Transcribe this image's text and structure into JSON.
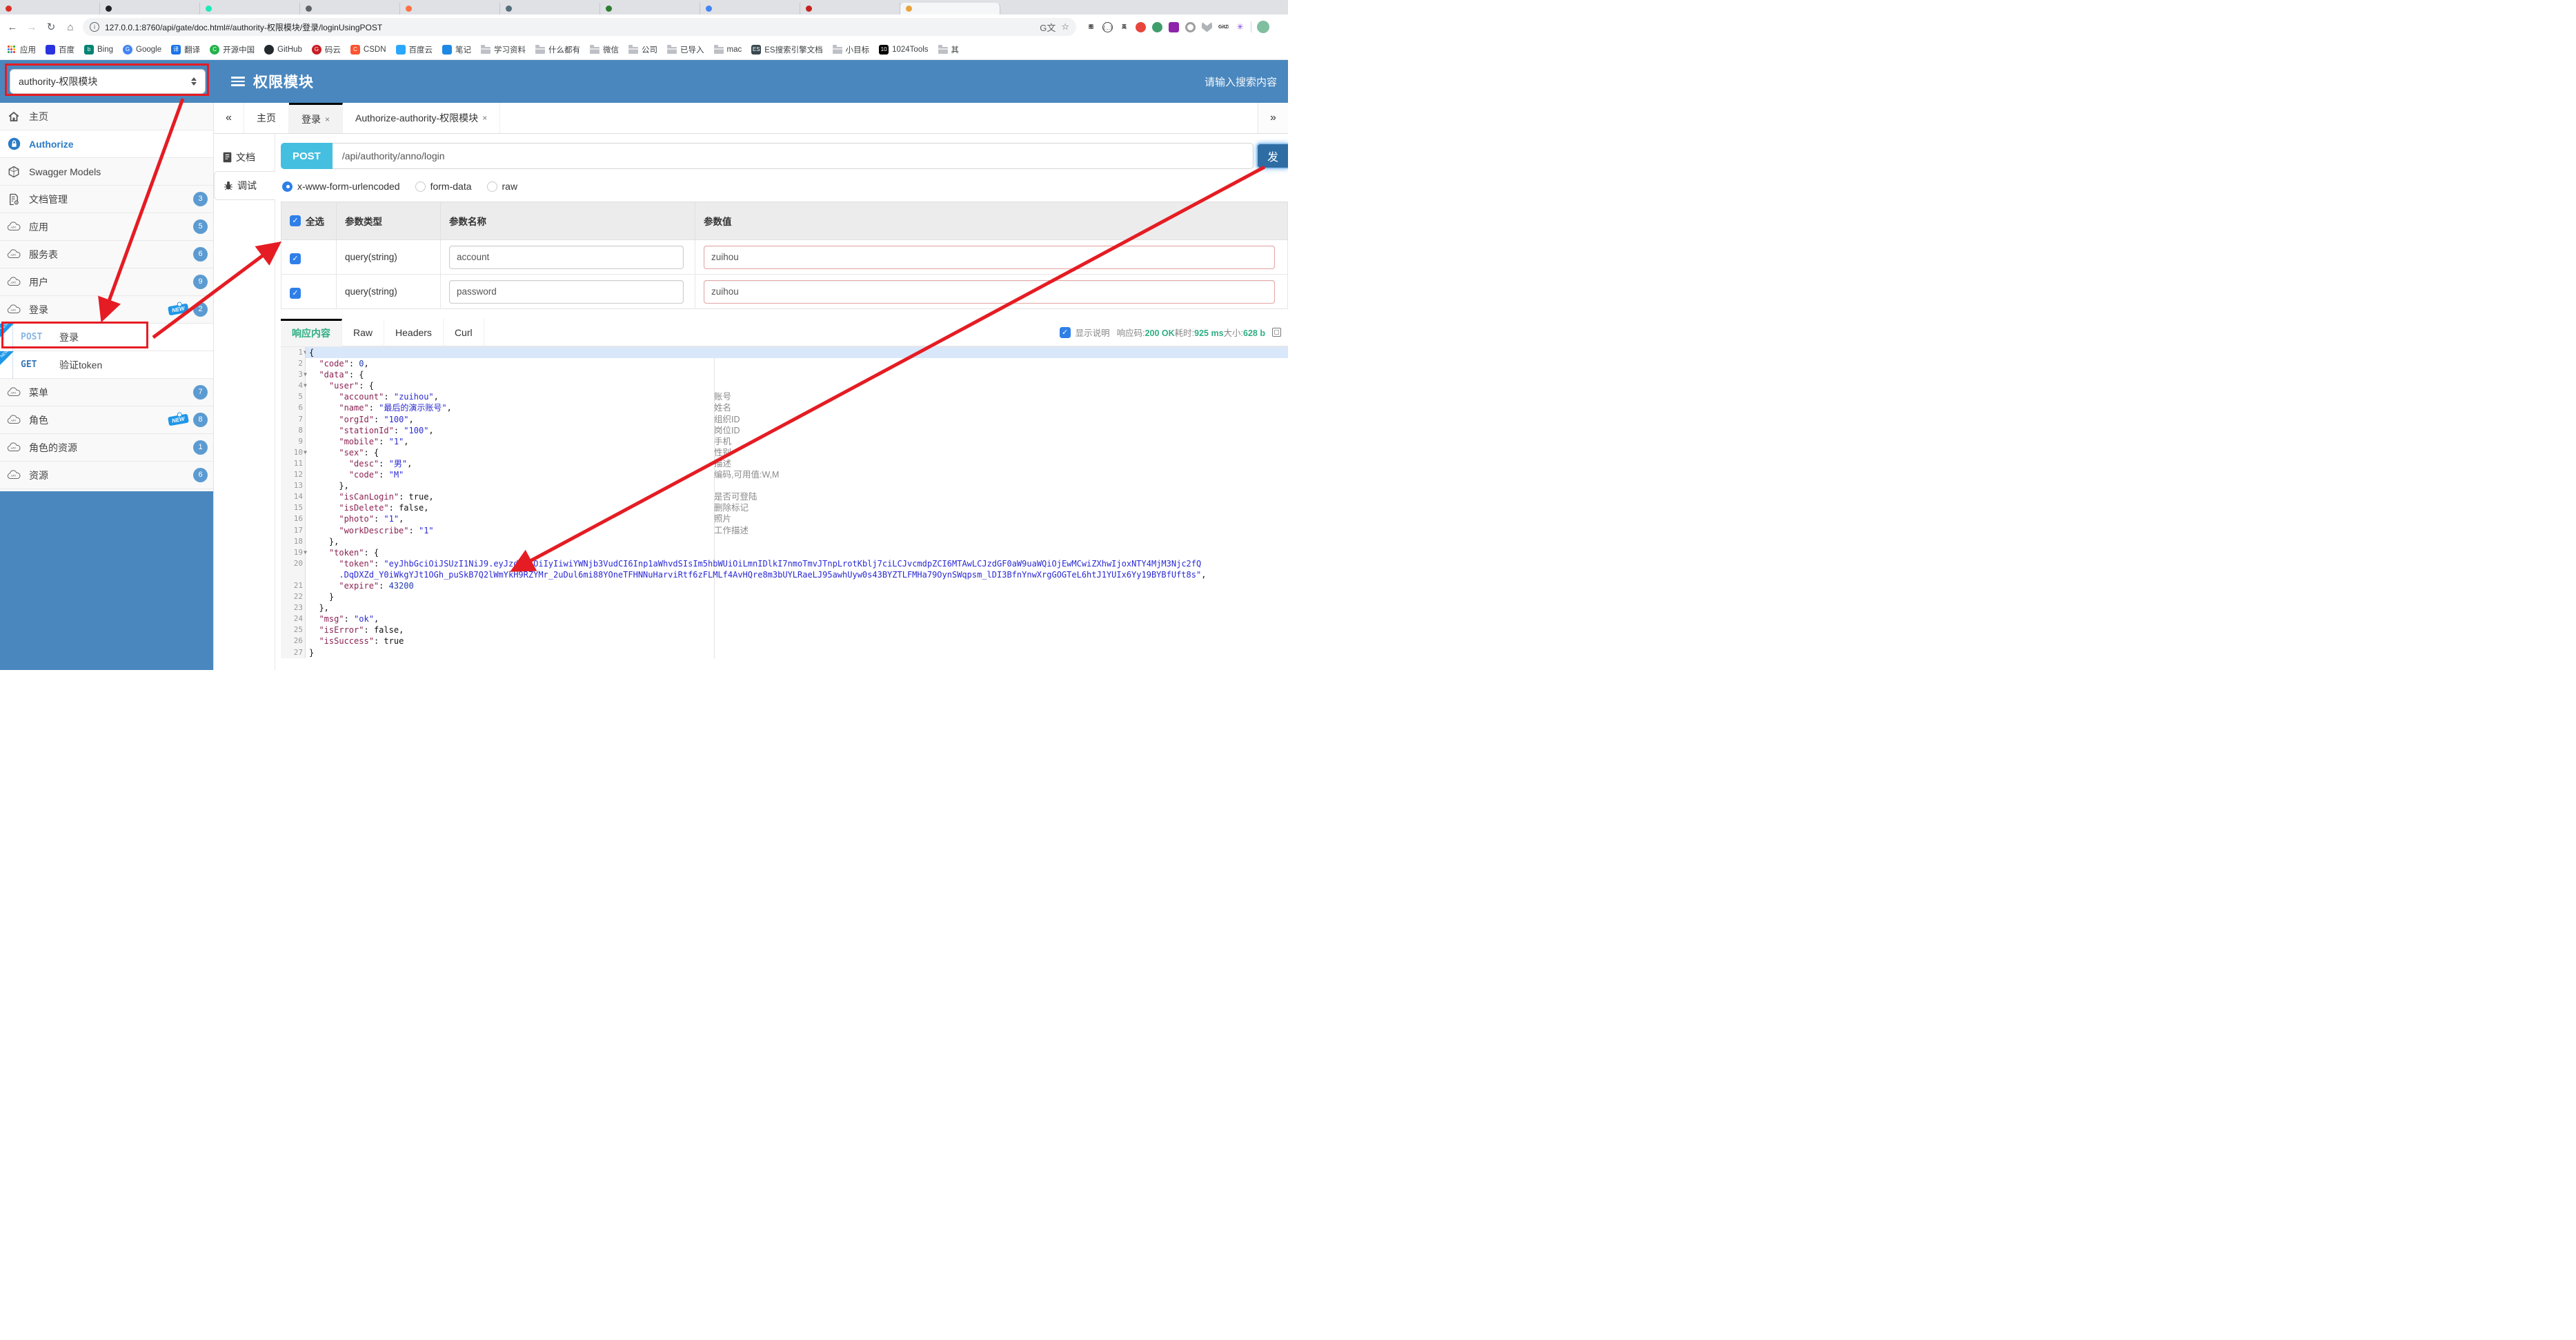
{
  "colors": {
    "header_blue": "#4a87be",
    "badge_blue": "#5b9bd1",
    "annotation_red": "#e51c23",
    "method_teal": "#45bfdf",
    "success_green": "#2fae83",
    "send_navy": "#2e6da4",
    "new_blue": "#1f97e8"
  },
  "browser": {
    "tabs": [
      {
        "color": "#d93025"
      },
      {
        "color": "#202124"
      },
      {
        "color": "#1de9b6"
      },
      {
        "color": "#5f6368"
      },
      {
        "color": "#ff7043"
      },
      {
        "color": "#546e7a"
      },
      {
        "color": "#2e7d32"
      },
      {
        "color": "#4285f4"
      },
      {
        "color": "#c5221f"
      },
      {
        "color": "#e8a33d",
        "active": true
      }
    ],
    "nav": {
      "back": "←",
      "forward": "→",
      "reload": "↻",
      "home": "⌂",
      "info": "ⓘ",
      "star": "☆"
    },
    "url": "127.0.0.1:8760/api/gate/doc.html#/authority-权限模块/登录/loginUsingPOST",
    "extensions": [
      {
        "kind": "txt",
        "label": "图",
        "bg": ""
      },
      {
        "kind": "outline",
        "label": "{…}",
        "bg": ""
      },
      {
        "kind": "txt",
        "label": "英",
        "bg": ""
      },
      {
        "kind": "round",
        "label": "",
        "bg": "#e8453c"
      },
      {
        "kind": "round",
        "label": "",
        "bg": "#3f9d6b"
      },
      {
        "kind": "sq",
        "label": "",
        "bg": "#8e24aa"
      },
      {
        "kind": "ring",
        "label": "",
        "bg": "#9e9e9e"
      },
      {
        "kind": "chev",
        "label": "",
        "bg": "#b0b4b8"
      },
      {
        "kind": "txt",
        "label": "GitZip",
        "bg": ""
      },
      {
        "kind": "star",
        "label": "✳",
        "bg": ""
      }
    ],
    "bookmarks": [
      {
        "label": "应用",
        "icon": "apps"
      },
      {
        "label": "百度",
        "icon": "sq",
        "bg": "#2932e1",
        "glyph": ""
      },
      {
        "label": "Bing",
        "icon": "sq",
        "bg": "#008373",
        "glyph": "b"
      },
      {
        "label": "Google",
        "icon": "round",
        "bg": "#4285f4",
        "glyph": "G"
      },
      {
        "label": "翻译",
        "icon": "sq",
        "bg": "#1a73e8",
        "glyph": "译"
      },
      {
        "label": "开源中国",
        "icon": "round",
        "bg": "#24b34b",
        "glyph": "C"
      },
      {
        "label": "GitHub",
        "icon": "round",
        "bg": "#24292e",
        "glyph": ""
      },
      {
        "label": "码云",
        "icon": "round",
        "bg": "#c71d23",
        "glyph": "G"
      },
      {
        "label": "CSDN",
        "icon": "sq",
        "bg": "#fc5531",
        "glyph": "C"
      },
      {
        "label": "百度云",
        "icon": "sq",
        "bg": "#2aa7ff",
        "glyph": ""
      },
      {
        "label": "笔记",
        "icon": "sq",
        "bg": "#1e88e5",
        "glyph": ""
      },
      {
        "label": "学习资料",
        "icon": "folder"
      },
      {
        "label": "什么都有",
        "icon": "folder"
      },
      {
        "label": "微信",
        "icon": "folder"
      },
      {
        "label": "公司",
        "icon": "folder"
      },
      {
        "label": "已导入",
        "icon": "folder"
      },
      {
        "label": "mac",
        "icon": "folder"
      },
      {
        "label": "ES搜索引擎文档",
        "icon": "sq",
        "bg": "#37474f",
        "glyph": "ES"
      },
      {
        "label": "小目标",
        "icon": "folder"
      },
      {
        "label": "1024Tools",
        "icon": "sq",
        "bg": "#000000",
        "glyph": "10"
      },
      {
        "label": "其",
        "icon": "folder"
      }
    ]
  },
  "header": {
    "module_select": "authority-权限模块",
    "title": "权限模块",
    "search_placeholder": "请输入搜索内容"
  },
  "sidebar": {
    "items": [
      {
        "label": "主页",
        "icon": "home"
      },
      {
        "label": "Authorize",
        "icon": "lock",
        "selected": true
      },
      {
        "label": "Swagger Models",
        "icon": "hexagon"
      },
      {
        "label": "文档管理",
        "icon": "docgear",
        "badge": "3"
      },
      {
        "label": "应用",
        "icon": "cloud",
        "badge": "5"
      },
      {
        "label": "服务表",
        "icon": "cloud",
        "badge": "6"
      },
      {
        "label": "用户",
        "icon": "cloud",
        "badge": "9"
      },
      {
        "label": "登录",
        "icon": "cloud",
        "badge": "2",
        "new": true
      },
      {
        "op": true,
        "method": "POST",
        "label": "登录",
        "corner_new": true
      },
      {
        "op": true,
        "method": "GET",
        "label": "验证token",
        "corner_new": true
      },
      {
        "label": "菜单",
        "icon": "cloud",
        "badge": "7"
      },
      {
        "label": "角色",
        "icon": "cloud",
        "badge": "8",
        "new": true
      },
      {
        "label": "角色的资源",
        "icon": "cloud",
        "badge": "1"
      },
      {
        "label": "资源",
        "icon": "cloud",
        "badge": "6"
      }
    ],
    "new_label": "NEW"
  },
  "tabbar": {
    "collapse": "«",
    "expand": "»",
    "close_glyph": "×",
    "tabs": [
      {
        "label": "主页"
      },
      {
        "label": "登录",
        "closable": true,
        "active": true
      },
      {
        "label": "Authorize-authority-权限模块",
        "closable": true
      }
    ]
  },
  "doc_panel": {
    "tabs": [
      {
        "label": "文档",
        "icon": "doc"
      },
      {
        "label": "调试",
        "icon": "bug",
        "active": true
      }
    ]
  },
  "endpoint": {
    "method": "POST",
    "path": "/api/authority/anno/login",
    "send_label": "发"
  },
  "body_type": {
    "options": [
      {
        "label": "x-www-form-urlencoded",
        "selected": true
      },
      {
        "label": "form-data",
        "selected": false
      },
      {
        "label": "raw",
        "selected": false
      }
    ]
  },
  "params_table": {
    "select_all_label": "全选",
    "check_glyph": "✓",
    "headers": [
      "参数类型",
      "参数名称",
      "参数值"
    ],
    "rows": [
      {
        "checked": true,
        "type": "query(string)",
        "name": "account",
        "value": "zuihou"
      },
      {
        "checked": true,
        "type": "query(string)",
        "name": "password",
        "value": "zuihou"
      }
    ]
  },
  "response": {
    "tabs": [
      {
        "label": "响应内容",
        "active": true
      },
      {
        "label": "Raw"
      },
      {
        "label": "Headers"
      },
      {
        "label": "Curl"
      }
    ],
    "show_desc_label": "显示说明",
    "meta": [
      {
        "label": "响应码:",
        "value": "200 OK"
      },
      {
        "label": "耗时:",
        "value": "925 ms"
      },
      {
        "label": "大小:",
        "value": "628 b"
      }
    ]
  },
  "code": {
    "fold_glyph": "▼",
    "lines": [
      {
        "n": 1,
        "fold": true,
        "active": true,
        "toks": [
          [
            "p",
            "{"
          ]
        ]
      },
      {
        "n": 2,
        "toks": [
          [
            "p",
            "  "
          ],
          [
            "k",
            "\"code\""
          ],
          [
            "p",
            ": "
          ],
          [
            "num",
            "0"
          ],
          [
            "p",
            ","
          ]
        ]
      },
      {
        "n": 3,
        "fold": true,
        "toks": [
          [
            "p",
            "  "
          ],
          [
            "k",
            "\"data\""
          ],
          [
            "p",
            ": {"
          ]
        ]
      },
      {
        "n": 4,
        "fold": true,
        "toks": [
          [
            "p",
            "    "
          ],
          [
            "k",
            "\"user\""
          ],
          [
            "p",
            ": {"
          ]
        ]
      },
      {
        "n": 5,
        "ann": "账号",
        "toks": [
          [
            "p",
            "      "
          ],
          [
            "k",
            "\"account\""
          ],
          [
            "p",
            ": "
          ],
          [
            "s",
            "\"zuihou\""
          ],
          [
            "p",
            ","
          ]
        ]
      },
      {
        "n": 6,
        "ann": "姓名",
        "toks": [
          [
            "p",
            "      "
          ],
          [
            "k",
            "\"name\""
          ],
          [
            "p",
            ": "
          ],
          [
            "s",
            "\"最后的演示账号\""
          ],
          [
            "p",
            ","
          ]
        ]
      },
      {
        "n": 7,
        "ann": "组织ID",
        "toks": [
          [
            "p",
            "      "
          ],
          [
            "k",
            "\"orgId\""
          ],
          [
            "p",
            ": "
          ],
          [
            "s",
            "\"100\""
          ],
          [
            "p",
            ","
          ]
        ]
      },
      {
        "n": 8,
        "ann": "岗位ID",
        "toks": [
          [
            "p",
            "      "
          ],
          [
            "k",
            "\"stationId\""
          ],
          [
            "p",
            ": "
          ],
          [
            "s",
            "\"100\""
          ],
          [
            "p",
            ","
          ]
        ]
      },
      {
        "n": 9,
        "ann": "手机",
        "toks": [
          [
            "p",
            "      "
          ],
          [
            "k",
            "\"mobile\""
          ],
          [
            "p",
            ": "
          ],
          [
            "s",
            "\"1\""
          ],
          [
            "p",
            ","
          ]
        ]
      },
      {
        "n": 10,
        "fold": true,
        "ann": "性别",
        "toks": [
          [
            "p",
            "      "
          ],
          [
            "k",
            "\"sex\""
          ],
          [
            "p",
            ": {"
          ]
        ]
      },
      {
        "n": 11,
        "ann": "描述",
        "toks": [
          [
            "p",
            "        "
          ],
          [
            "k",
            "\"desc\""
          ],
          [
            "p",
            ": "
          ],
          [
            "s",
            "\"男\""
          ],
          [
            "p",
            ","
          ]
        ]
      },
      {
        "n": 12,
        "ann": "编码,可用值:W,M",
        "toks": [
          [
            "p",
            "        "
          ],
          [
            "k",
            "\"code\""
          ],
          [
            "p",
            ": "
          ],
          [
            "s",
            "\"M\""
          ]
        ]
      },
      {
        "n": 13,
        "toks": [
          [
            "p",
            "      },"
          ]
        ]
      },
      {
        "n": 14,
        "ann": "是否可登陆",
        "toks": [
          [
            "p",
            "      "
          ],
          [
            "k",
            "\"isCanLogin\""
          ],
          [
            "p",
            ": "
          ],
          [
            "p",
            "true"
          ],
          [
            "p",
            ","
          ]
        ]
      },
      {
        "n": 15,
        "ann": "删除标记",
        "toks": [
          [
            "p",
            "      "
          ],
          [
            "k",
            "\"isDelete\""
          ],
          [
            "p",
            ": "
          ],
          [
            "p",
            "false"
          ],
          [
            "p",
            ","
          ]
        ]
      },
      {
        "n": 16,
        "ann": "照片",
        "toks": [
          [
            "p",
            "      "
          ],
          [
            "k",
            "\"photo\""
          ],
          [
            "p",
            ": "
          ],
          [
            "s",
            "\"1\""
          ],
          [
            "p",
            ","
          ]
        ]
      },
      {
        "n": 17,
        "ann": "工作描述",
        "toks": [
          [
            "p",
            "      "
          ],
          [
            "k",
            "\"workDescribe\""
          ],
          [
            "p",
            ": "
          ],
          [
            "s",
            "\"1\""
          ]
        ]
      },
      {
        "n": 18,
        "toks": [
          [
            "p",
            "    },"
          ]
        ]
      },
      {
        "n": 19,
        "fold": true,
        "toks": [
          [
            "p",
            "    "
          ],
          [
            "k",
            "\"token\""
          ],
          [
            "p",
            ": {"
          ]
        ]
      },
      {
        "n": 20,
        "wrap": true,
        "toks": [
          [
            "p",
            "      "
          ],
          [
            "k",
            "\"token\""
          ],
          [
            "p",
            ": "
          ],
          [
            "s",
            "\"eyJhbGciOiJSUzI1NiJ9.eyJzdWIiOiIyIiwiYWNjb3VudCI6Inp1aWhvdSIsIm5hbWUiOiLmnIDlkI7nmoTmvJTnpLrotKblj7ciLCJvcmdpZCI6MTAwLCJzdGF0aW9uaWQiOjEwMCwiZXhwIjoxNTY4MjM3Njc2fQ"
          ],
          [
            "br",
            ""
          ],
          [
            "s",
            "      .DqDXZd_Y0iWkgYJt1OGh_puSkB7Q2lWmYkH9RZYMr_2uDul6mi88YOneTFHNNuHarviRtf6zFLMLf4AvHQre8m3bUYLRaeLJ95awhUyw0s43BYZTLFMHa79OynSWqpsm_lDI3BfnYnwXrgGOGTeL6htJ1YUIx6Yy19BYBfUft8s\""
          ],
          [
            "p",
            ","
          ]
        ]
      },
      {
        "n": 21,
        "toks": [
          [
            "p",
            "      "
          ],
          [
            "k",
            "\"expire\""
          ],
          [
            "p",
            ": "
          ],
          [
            "num",
            "43200"
          ]
        ]
      },
      {
        "n": 22,
        "toks": [
          [
            "p",
            "    }"
          ]
        ]
      },
      {
        "n": 23,
        "toks": [
          [
            "p",
            "  },"
          ]
        ]
      },
      {
        "n": 24,
        "toks": [
          [
            "p",
            "  "
          ],
          [
            "k",
            "\"msg\""
          ],
          [
            "p",
            ": "
          ],
          [
            "s",
            "\"ok\""
          ],
          [
            "p",
            ","
          ]
        ]
      },
      {
        "n": 25,
        "toks": [
          [
            "p",
            "  "
          ],
          [
            "k",
            "\"isError\""
          ],
          [
            "p",
            ": "
          ],
          [
            "p",
            "false"
          ],
          [
            "p",
            ","
          ]
        ]
      },
      {
        "n": 26,
        "toks": [
          [
            "p",
            "  "
          ],
          [
            "k",
            "\"isSuccess\""
          ],
          [
            "p",
            ": "
          ],
          [
            "p",
            "true"
          ]
        ]
      },
      {
        "n": 27,
        "toks": [
          [
            "p",
            "}"
          ]
        ]
      }
    ]
  }
}
